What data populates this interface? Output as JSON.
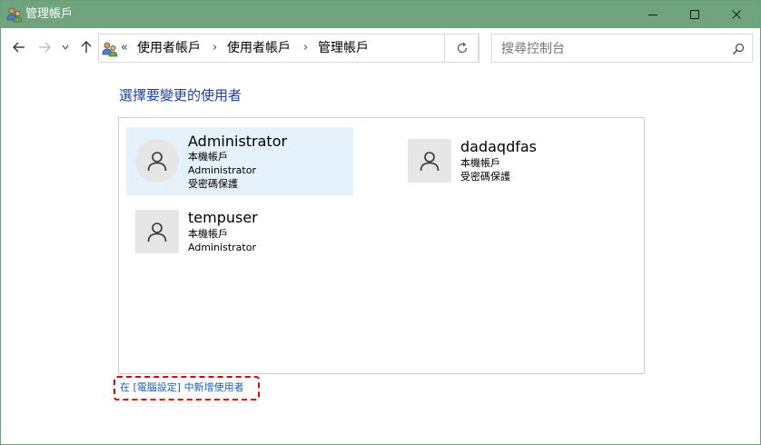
{
  "window": {
    "title": "管理帳戶",
    "icon": "users-icon",
    "controls": [
      "minimize-icon",
      "maximize-icon",
      "close-icon"
    ]
  },
  "nav": {
    "back": "arrow-left-icon",
    "forward": "arrow-right-icon",
    "recent": "chevron-down-icon",
    "up": "arrow-up-icon"
  },
  "address": {
    "overflow": "«",
    "breadcrumbs": [
      "使用者帳戶",
      "使用者帳戶",
      "管理帳戶"
    ],
    "separator": "›",
    "refresh_icon": "refresh-icon"
  },
  "search": {
    "placeholder": "搜尋控制台",
    "icon": "search-icon"
  },
  "main": {
    "heading": "選擇要變更的使用者",
    "users": [
      {
        "name": "Administrator",
        "details": [
          "本機帳戶",
          "Administrator",
          "受密碼保護"
        ],
        "selected": true
      },
      {
        "name": "dadaqdfas",
        "details": [
          "本機帳戶",
          "受密碼保護"
        ],
        "selected": false
      },
      {
        "name": "tempuser",
        "details": [
          "本機帳戶",
          "Administrator"
        ],
        "selected": false
      }
    ],
    "add_user_link": "在 [電腦設定] 中新增使用者"
  },
  "colors": {
    "titlebar": "#6fa47e",
    "heading": "#1e3f9e",
    "link": "#1a5fb4",
    "selection": "#e5f1fb",
    "highlight_border": "#e00000"
  }
}
